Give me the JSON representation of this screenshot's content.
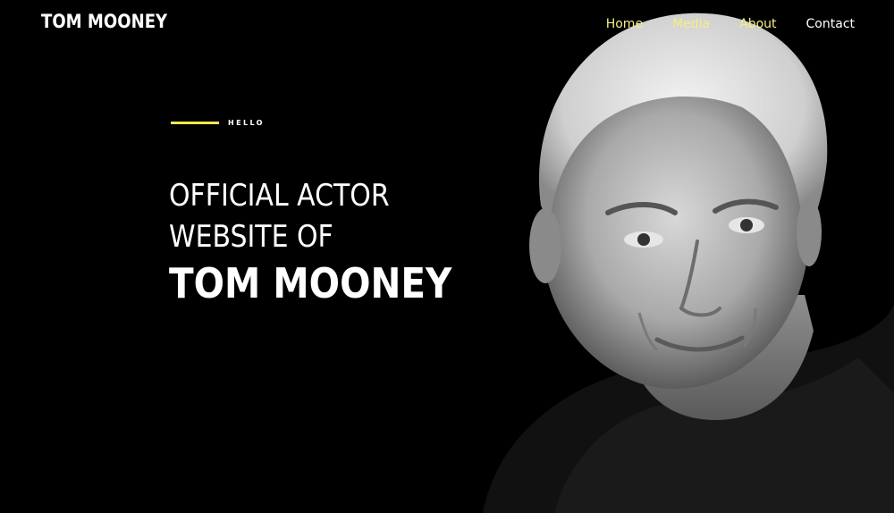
{
  "site": {
    "brand": "TOM MOONEY"
  },
  "nav": {
    "items": [
      {
        "label": "Home",
        "style": "accent"
      },
      {
        "label": "Media",
        "style": "accent"
      },
      {
        "label": "About",
        "style": "accent"
      },
      {
        "label": "Contact",
        "style": "plain"
      }
    ]
  },
  "hero": {
    "eyebrow": "HELLO",
    "line1": "OFFICIAL ACTOR",
    "line2": "WEBSITE OF",
    "name": "TOM MOONEY",
    "image": "black-and-white-portrait-photo"
  },
  "colors": {
    "background": "#000000",
    "accent": "#f2e84f",
    "nav_accent": "#f4ee8a",
    "text": "#ffffff"
  }
}
